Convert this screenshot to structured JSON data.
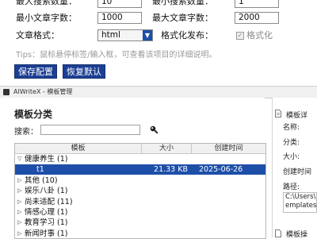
{
  "settings": {
    "max_search_label": "最大搜索数量：",
    "max_search_value": "10",
    "min_search_label": "最小搜索数量：",
    "min_search_value": "1",
    "min_words_label": "最小文章字数：",
    "min_words_value": "1000",
    "max_words_label": "最大文章字数：",
    "max_words_value": "2000",
    "format_label": "文章格式：",
    "format_value": "html",
    "publish_label": "格式化发布：",
    "publish_checkbox_label": "格式化",
    "publish_checked": true,
    "tips": "Tips：鼠标悬停标签/输入框，可查看该项目的详细说明。",
    "save_button": "保存配置",
    "reset_button": "恢复默认"
  },
  "window": {
    "title": "AIWriteX - 模板管理"
  },
  "template_panel": {
    "title": "模板分类",
    "search_label": "搜索：",
    "search_value": "",
    "columns": [
      "模板",
      "大小",
      "创建时间"
    ],
    "rows": [
      {
        "expander": "▽",
        "name": "健康养生 (1)",
        "size": "",
        "created": "",
        "indent": 0,
        "selected": false
      },
      {
        "expander": "",
        "name": "t1",
        "size": "21.33 KB",
        "created": "2025-06-26",
        "indent": 1,
        "selected": true
      },
      {
        "expander": "▷",
        "name": "其他 (10)",
        "size": "",
        "created": "",
        "indent": 0,
        "selected": false
      },
      {
        "expander": "▷",
        "name": "娱乐八卦 (1)",
        "size": "",
        "created": "",
        "indent": 0,
        "selected": false
      },
      {
        "expander": "▷",
        "name": "尚未适配 (11)",
        "size": "",
        "created": "",
        "indent": 0,
        "selected": false
      },
      {
        "expander": "▷",
        "name": "情感心理 (1)",
        "size": "",
        "created": "",
        "indent": 0,
        "selected": false
      },
      {
        "expander": "▷",
        "name": "教育学习 (1)",
        "size": "",
        "created": "",
        "indent": 0,
        "selected": false
      },
      {
        "expander": "▷",
        "name": "新闻时事 (1)",
        "size": "",
        "created": "",
        "indent": 0,
        "selected": false
      }
    ]
  },
  "detail_panel": {
    "group_title": "模板详",
    "name_label": "名称:",
    "category_label": "分类:",
    "size_label": "大小:",
    "created_label": "创建时间",
    "path_label": "路径:",
    "path_line1": "C:\\Users\\",
    "path_line2": "emplates",
    "group2_title": "模板操"
  },
  "colors": {
    "accent": "#1c3f93",
    "selection": "#1e4fa8",
    "tips_text": "#9a9a9a"
  }
}
